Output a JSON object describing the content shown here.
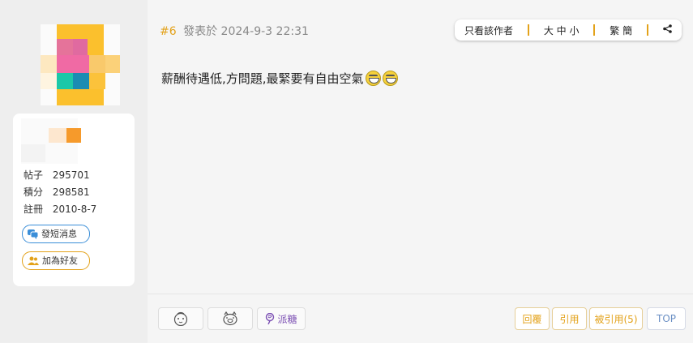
{
  "profile": {
    "stats": [
      {
        "label": "帖子",
        "value": "295701"
      },
      {
        "label": "積分",
        "value": "298581"
      },
      {
        "label": "註冊",
        "value": "2010-8-7"
      }
    ],
    "message_button": "發短消息",
    "add_friend_button": "加為好友"
  },
  "post": {
    "number": "#6",
    "posted_prefix": "發表於",
    "posted_at": "2024-9-3 22:31",
    "body": "薪酬待遇低,方問題,最緊要有自由空氣",
    "emoticons": [
      "grin-emoji",
      "grin-emoji"
    ]
  },
  "toolbar": {
    "only_author": "只看該作者",
    "font_size": "大 中 小",
    "script": "繁 簡",
    "share_icon": "share-icon"
  },
  "footer": {
    "reactions": [
      "smile-face-icon",
      "pig-face-icon"
    ],
    "candy": "派糖",
    "reply": "回覆",
    "quote": "引用",
    "quoted_by": "被引用(5)",
    "top": "TOP"
  },
  "colors": {
    "accent": "#e3a21a",
    "link_blue": "#3a8ed8",
    "purple": "#7b4fb3"
  }
}
